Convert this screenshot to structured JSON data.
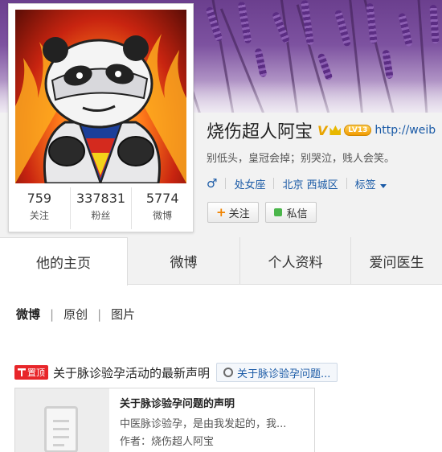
{
  "profile": {
    "name": "烧伤超人阿宝",
    "verified_badge": "V",
    "level_badge": "LV13",
    "url": "http://weib",
    "motto": "别低头，皇冠会掉；别哭泣，贱人会笑。",
    "gender_icon": "male-icon",
    "constellation": "处女座",
    "location": "北京 西城区",
    "tags_label": "标签"
  },
  "stats": [
    {
      "value": "759",
      "label": "关注"
    },
    {
      "value": "337831",
      "label": "粉丝"
    },
    {
      "value": "5774",
      "label": "微博"
    }
  ],
  "actions": {
    "follow_label": "关注",
    "message_label": "私信"
  },
  "tabs": [
    {
      "label": "他的主页"
    },
    {
      "label": "微博"
    },
    {
      "label": "个人资料"
    },
    {
      "label": "爱问医生"
    }
  ],
  "subnav": [
    "微博",
    "原创",
    "图片"
  ],
  "pinned": {
    "badge": "置顶",
    "title": "关于脉诊验孕活动的最新声明",
    "link_text": "关于脉诊验孕问题..."
  },
  "article": {
    "title": "关于脉诊验孕问题的声明",
    "summary": "中医脉诊验孕，是由我发起的，我...",
    "author": "作者：烧伤超人阿宝"
  },
  "colors": {
    "link": "#1a5aa6",
    "pin_red": "#e8262a",
    "banner_purple": "#6b3f8e",
    "verified_gold": "#e8a400"
  }
}
